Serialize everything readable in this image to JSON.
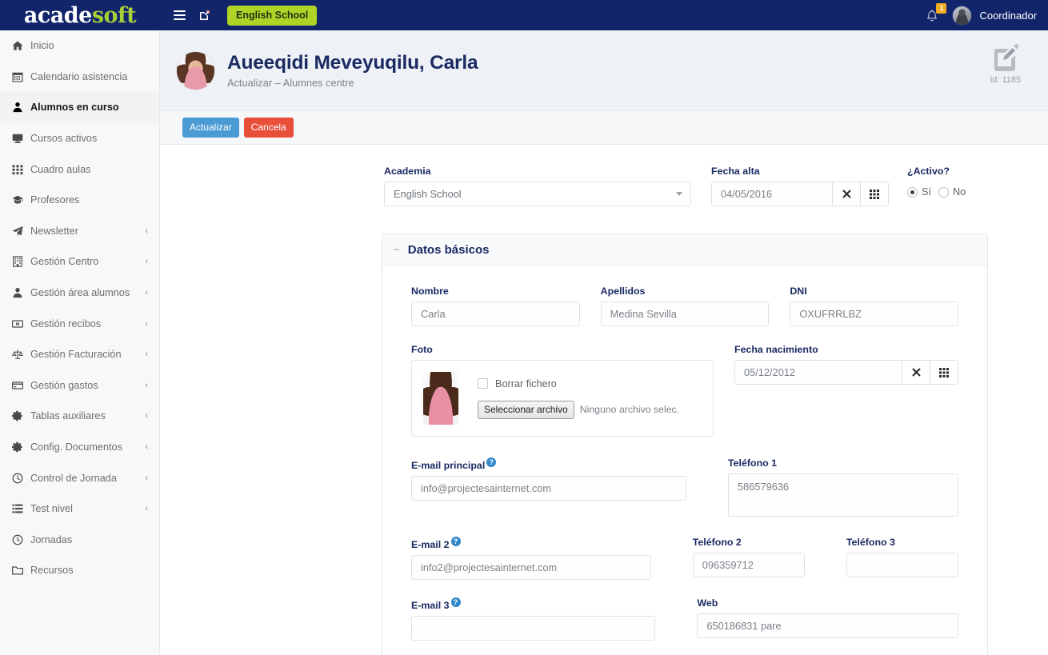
{
  "brand": {
    "part1": "acade",
    "part2": "soft"
  },
  "topbar": {
    "menu_toggle": "hamburger-menu",
    "external_link": "external-link",
    "school_badge": "English School",
    "notification_count": "1",
    "user_name": "Coordinador"
  },
  "sidebar": {
    "items": [
      {
        "label": "Inicio",
        "icon": "home-icon",
        "caret": "",
        "active": false
      },
      {
        "label": "Calendario asistencia",
        "icon": "calendar-icon",
        "caret": "",
        "active": false
      },
      {
        "label": "Alumnos en curso",
        "icon": "user-icon",
        "caret": "",
        "active": true
      },
      {
        "label": "Cursos activos",
        "icon": "monitor-icon",
        "caret": "",
        "active": false
      },
      {
        "label": "Cuadro aulas",
        "icon": "grid-icon",
        "caret": "",
        "active": false
      },
      {
        "label": "Profesores",
        "icon": "graduation-cap-icon",
        "caret": "",
        "active": false
      },
      {
        "label": "Newsletter",
        "icon": "paper-plane-icon",
        "caret": "‹",
        "active": false
      },
      {
        "label": "Gestión Centro",
        "icon": "building-icon",
        "caret": "‹",
        "active": false
      },
      {
        "label": "Gestión área alumnos",
        "icon": "user-icon",
        "caret": "‹",
        "active": false
      },
      {
        "label": "Gestión recibos",
        "icon": "money-icon",
        "caret": "‹",
        "active": false
      },
      {
        "label": "Gestión Facturación",
        "icon": "scales-icon",
        "caret": "‹",
        "active": false
      },
      {
        "label": "Gestión gastos",
        "icon": "credit-card-icon",
        "caret": "‹",
        "active": false
      },
      {
        "label": "Tablas auxiliares",
        "icon": "gear-icon",
        "caret": "‹",
        "active": false
      },
      {
        "label": "Config. Documentos",
        "icon": "gear-icon",
        "caret": "‹",
        "active": false
      },
      {
        "label": "Control de Jornada",
        "icon": "clock-icon",
        "caret": "‹",
        "active": false
      },
      {
        "label": "Test nivel",
        "icon": "list-icon",
        "caret": "‹",
        "active": false
      },
      {
        "label": "Jornadas",
        "icon": "clock-icon",
        "caret": "",
        "active": false
      },
      {
        "label": "Recursos",
        "icon": "folder-icon",
        "caret": "",
        "active": false
      }
    ]
  },
  "page": {
    "title": "Aueeqidi Meveyuqilu, Carla",
    "subtitle": "Actualizar – Alumnes centre",
    "record_id": "id: 1185",
    "edit_icon": "edit-pencil-icon"
  },
  "actions": {
    "update_label": "Actualizar",
    "cancel_label": "Cancela",
    "update_color": "#4a9ad4",
    "cancel_color": "#e8503a"
  },
  "top_form": {
    "academia": {
      "label": "Academia",
      "value": "English School"
    },
    "fecha_alta": {
      "label": "Fecha alta",
      "value": "04/05/2016",
      "clear_icon": "clear-x-icon",
      "calendar_icon": "calendar-grid-icon"
    },
    "activo": {
      "label": "¿Activo?",
      "options": [
        {
          "label": "Sí",
          "checked": true
        },
        {
          "label": "No",
          "checked": false
        }
      ]
    }
  },
  "panel": {
    "title": "Datos básicos",
    "collapse_icon": "minus-collapse-icon",
    "nombre": {
      "label": "Nombre",
      "value": "Carla"
    },
    "apellidos": {
      "label": "Apellidos",
      "value": "Medina Sevilla"
    },
    "dni": {
      "label": "DNI",
      "value": "OXUFRRLBZ"
    },
    "foto": {
      "label": "Foto",
      "delete_checkbox_label": "Borrar fichero",
      "file_button_label": "Seleccionar archivo",
      "file_status": "Ninguno archivo selec."
    },
    "fecha_nacimiento": {
      "label": "Fecha nacimiento",
      "value": "05/12/2012",
      "clear_icon": "clear-x-icon",
      "calendar_icon": "calendar-grid-icon"
    },
    "email_principal": {
      "label": "E-mail principal",
      "value": "info@projectesainternet.com",
      "help": "?"
    },
    "telefono1": {
      "label": "Teléfono 1",
      "value": "586579636"
    },
    "email2": {
      "label": "E-mail 2",
      "value": "info2@projectesainternet.com",
      "help": "?"
    },
    "telefono2": {
      "label": "Teléfono 2",
      "value": "096359712"
    },
    "telefono3": {
      "label": "Teléfono 3",
      "value": ""
    },
    "email3": {
      "label": "E-mail 3",
      "value": "",
      "help": "?"
    },
    "web": {
      "label": "Web",
      "value": "650186831 pare"
    }
  }
}
